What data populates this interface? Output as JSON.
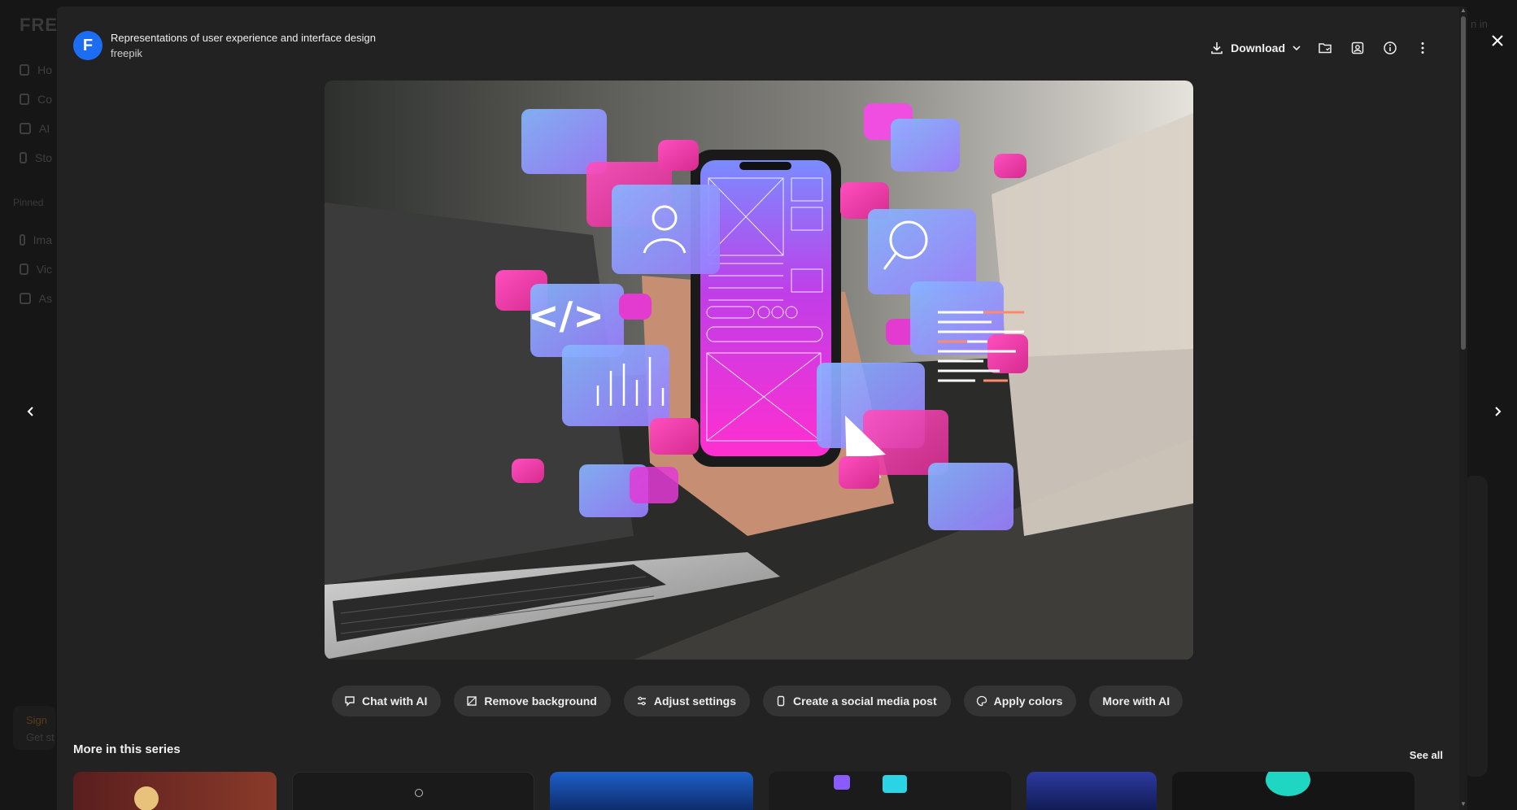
{
  "background_page": {
    "logo": "FRE",
    "nav_items": [
      "Ho",
      "Co",
      "AI",
      "Sto"
    ],
    "pinned_label": "Pinned",
    "pinned_items": [
      "Ima",
      "Vic",
      "As"
    ],
    "signin_partial": "Sign",
    "get_started_partial": "Get st",
    "topright_partial": "n in"
  },
  "modal": {
    "title": "Representations of user experience and interface design",
    "author": "freepik",
    "avatar_letter": "F",
    "toolbar": {
      "download_label": "Download",
      "icons": [
        "folder-heart-icon",
        "user-collection-icon",
        "info-icon",
        "more-vertical-icon"
      ]
    },
    "image_alt": "Hand holding phone with UI wireframe and floating app icons above a laptop",
    "actions": [
      {
        "label": "Chat with AI",
        "icon": "chat-icon"
      },
      {
        "label": "Remove background",
        "icon": "remove-bg-icon"
      },
      {
        "label": "Adjust settings",
        "icon": "sliders-icon"
      },
      {
        "label": "Create a social media post",
        "icon": "phone-icon"
      },
      {
        "label": "Apply colors",
        "icon": "palette-icon"
      },
      {
        "label": "More with AI",
        "icon": ""
      }
    ],
    "series_title": "More in this series",
    "see_all": "See all"
  },
  "colors": {
    "accent": "#1c6df2",
    "modal_bg": "#222222",
    "button_bg": "#343434",
    "magenta": "#e33bb0",
    "blue": "#7fa8ff"
  }
}
